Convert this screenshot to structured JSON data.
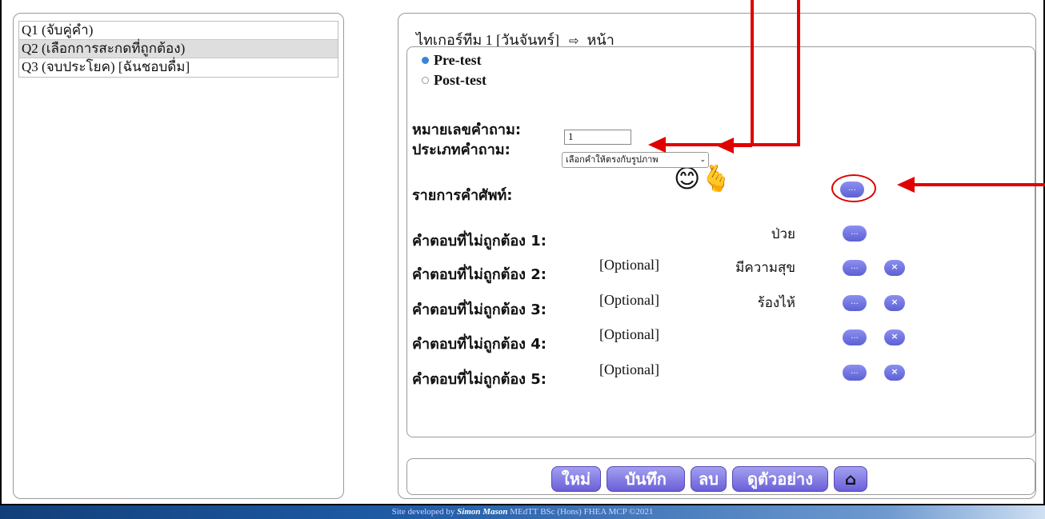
{
  "questions": [
    {
      "label": "Q1 (จับคู่คำ)",
      "selected": false
    },
    {
      "label": "Q2 (เลือกการสะกดที่ถูกต้อง)",
      "selected": true
    },
    {
      "label": "Q3 (จบประโยค) [ฉันชอบดื่ม]",
      "selected": false
    }
  ],
  "header": {
    "title": "ไทเกอร์ทีม 1 [วันจันทร์]",
    "arrow": "⇨",
    "page": "หน้า"
  },
  "test_type": {
    "pre": "Pre-test",
    "post": "Post-test",
    "selected": "pre"
  },
  "fields": {
    "question_number_label": "หมายเลขคำถาม:",
    "question_number_value": "1",
    "question_type_label": "ประเภทคำถาม:",
    "question_type_value": "เลือกคำให้ตรงกับรูปภาพ",
    "vocab_label": "รายการคำศัพท์:"
  },
  "answers": [
    {
      "label": "คำตอบที่ไม่ถูกต้อง 1:",
      "optional": "",
      "word": "ป่วย",
      "deletable": false
    },
    {
      "label": "คำตอบที่ไม่ถูกต้อง 2:",
      "optional": "[Optional]",
      "word": "มีความสุข",
      "deletable": true
    },
    {
      "label": "คำตอบที่ไม่ถูกต้อง 3:",
      "optional": "[Optional]",
      "word": "ร้องไห้",
      "deletable": true
    },
    {
      "label": "คำตอบที่ไม่ถูกต้อง 4:",
      "optional": "[Optional]",
      "word": "",
      "deletable": true
    },
    {
      "label": "คำตอบที่ไม่ถูกต้อง 5:",
      "optional": "[Optional]",
      "word": "",
      "deletable": true
    }
  ],
  "pill": {
    "more": "...",
    "delete": "×"
  },
  "buttons": {
    "new": "ใหม่",
    "save": "บันทึก",
    "delete": "ลบ",
    "preview": "ดูตัวอย่าง",
    "home": "⌂"
  },
  "emoji": "😊🫰",
  "footer": {
    "prefix": "Site developed by",
    "author": "Simon Mason",
    "credentials": "MEdTT BSc (Hons) FHEA MCP ©2021"
  },
  "colors": {
    "accent": "#6b5fd8",
    "annotation": "#e00000",
    "radio": "#3a84d8"
  }
}
